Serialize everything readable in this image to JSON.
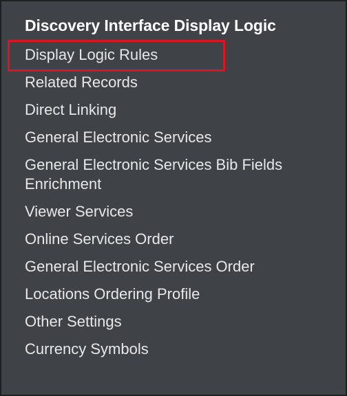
{
  "menu": {
    "header": "Discovery Interface Display Logic",
    "items": [
      {
        "label": "Display Logic Rules"
      },
      {
        "label": "Related Records"
      },
      {
        "label": "Direct Linking"
      },
      {
        "label": "General Electronic Services"
      },
      {
        "label": "General Electronic Services Bib Fields Enrichment"
      },
      {
        "label": "Viewer Services"
      },
      {
        "label": "Online Services Order"
      },
      {
        "label": "General Electronic Services Order"
      },
      {
        "label": "Locations Ordering Profile"
      },
      {
        "label": "Other Settings"
      },
      {
        "label": "Currency Symbols"
      }
    ]
  },
  "colors": {
    "panel_background": "#3f4246",
    "highlight": "#e0141e",
    "text": "#e8e8e8",
    "header_text": "#ffffff"
  }
}
